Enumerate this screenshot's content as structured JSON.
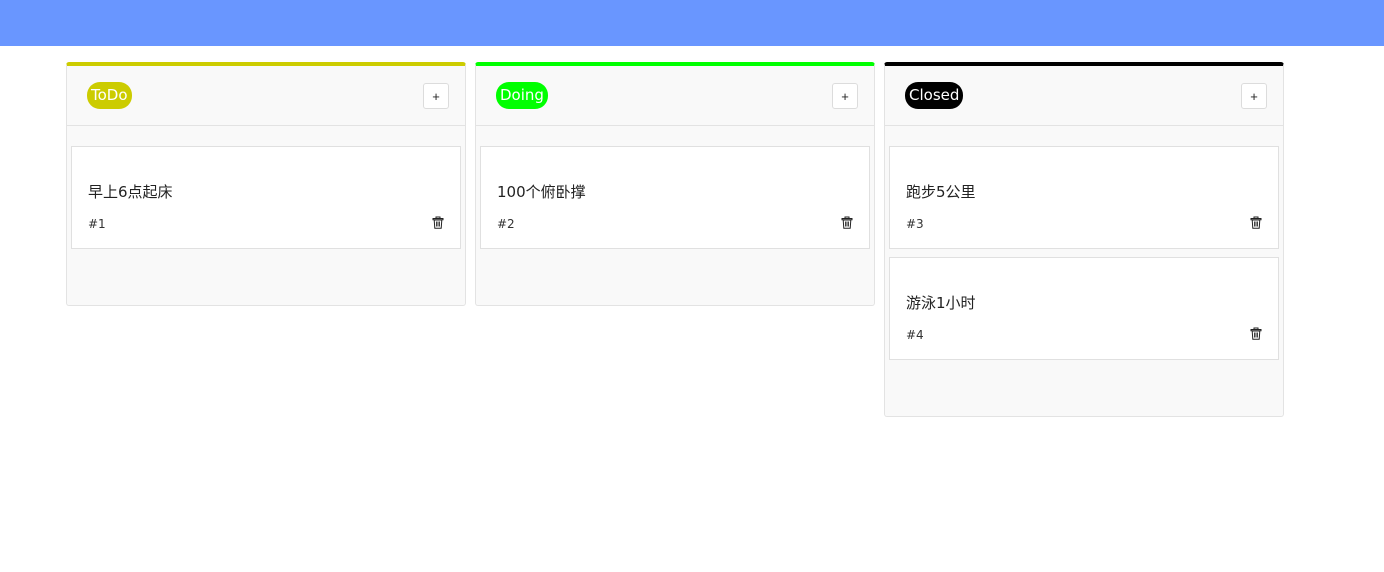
{
  "colors": {
    "topbar": "#6996ff",
    "todo": "#cccc00",
    "doing": "#00ff00",
    "closed": "#000000"
  },
  "columns": [
    {
      "label": "ToDo",
      "color": "#cccc00",
      "add_label": "+",
      "cards": [
        {
          "title": "早上6点起床",
          "id": "#1",
          "delete_icon": "trash-icon"
        }
      ]
    },
    {
      "label": "Doing",
      "color": "#00ff00",
      "add_label": "+",
      "cards": [
        {
          "title": "100个俯卧撑",
          "id": "#2",
          "delete_icon": "trash-icon"
        }
      ]
    },
    {
      "label": "Closed",
      "color": "#000000",
      "add_label": "+",
      "cards": [
        {
          "title": "跑步5公里",
          "id": "#3",
          "delete_icon": "trash-icon"
        },
        {
          "title": "游泳1小时",
          "id": "#4",
          "delete_icon": "trash-icon"
        }
      ]
    }
  ]
}
